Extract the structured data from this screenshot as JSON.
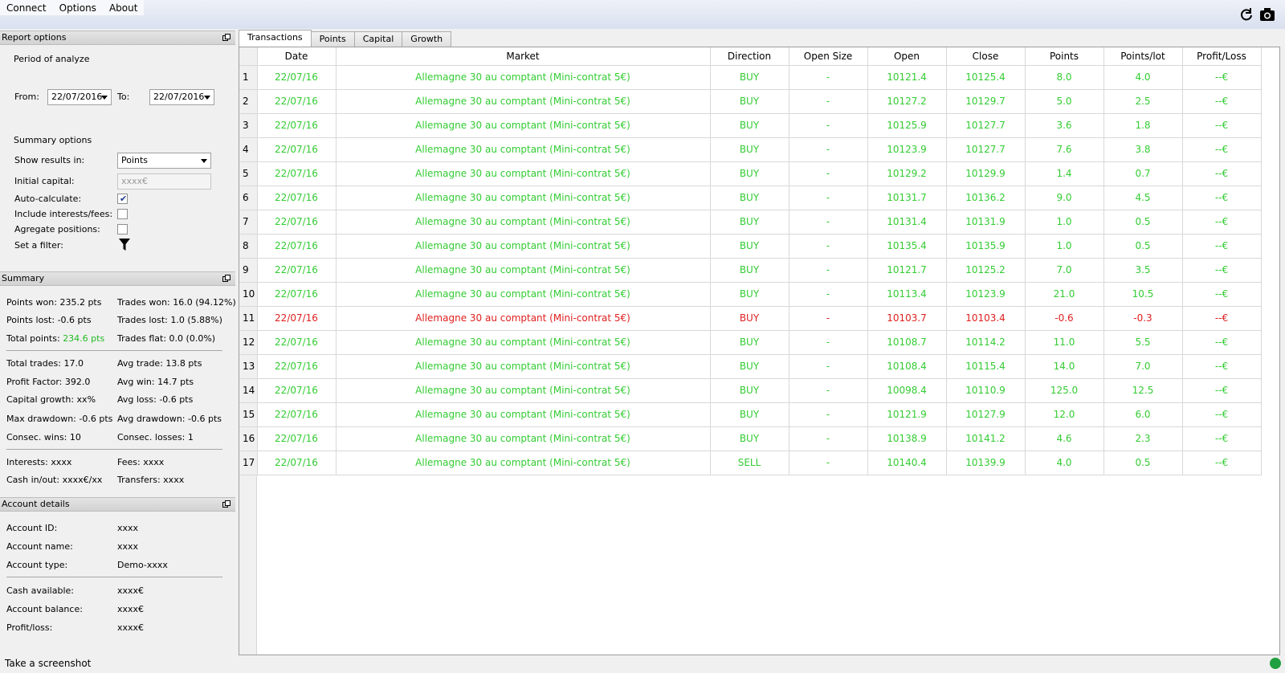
{
  "menu": [
    "Connect",
    "Options",
    "About"
  ],
  "toolbar": {
    "refresh_icon": "refresh-icon",
    "camera_icon": "camera-icon"
  },
  "report_options": {
    "header": "Report options",
    "period_label": "Period of analyze",
    "from_label": "From:",
    "from_value": "22/07/2016",
    "to_label": "To:",
    "to_value": "22/07/2016",
    "summary_options_label": "Summary options",
    "show_results_label": "Show results in:",
    "show_results_value": "Points",
    "initial_capital_label": "Initial capital:",
    "initial_capital_placeholder": "xxxx€",
    "auto_calculate_label": "Auto-calculate:",
    "auto_calculate_checked": true,
    "include_interests_label": "Include interests/fees:",
    "include_interests_checked": false,
    "aggregate_label": "Agregate positions:",
    "aggregate_checked": false,
    "filter_label": "Set a filter:"
  },
  "summary": {
    "header": "Summary",
    "points_won_label": "Points won:",
    "points_won": "235.2 pts",
    "trades_won_label": "Trades won:",
    "trades_won": "16.0 (94.12%)",
    "points_lost_label": "Points lost:",
    "points_lost": "-0.6 pts",
    "trades_lost_label": "Trades lost:",
    "trades_lost": "1.0 (5.88%)",
    "total_points_label": "Total points:",
    "total_points": "234.6 pts",
    "trades_flat_label": "Trades flat:",
    "trades_flat": "0.0 (0.0%)",
    "total_trades_label": "Total trades:",
    "total_trades": "17.0",
    "avg_trade_label": "Avg trade:",
    "avg_trade": "13.8 pts",
    "profit_factor_label": "Profit Factor:",
    "profit_factor": "392.0",
    "avg_win_label": "Avg win:",
    "avg_win": "14.7 pts",
    "capital_growth_label": "Capital growth:",
    "capital_growth": "xx%",
    "avg_loss_label": "Avg loss:",
    "avg_loss": "-0.6 pts",
    "max_drawdown_label": "Max drawdown:",
    "max_drawdown": "-0.6 pts",
    "avg_drawdown_label": "Avg drawdown:",
    "avg_drawdown": "-0.6 pts",
    "consec_wins_label": "Consec. wins:",
    "consec_wins": "10",
    "consec_losses_label": "Consec. losses:",
    "consec_losses": "1",
    "interests_label": "Interests:",
    "interests": "xxxx",
    "fees_label": "Fees:",
    "fees": "xxxx",
    "cash_inout_label": "Cash in/out:",
    "cash_inout": "xxxx€/xx",
    "transfers_label": "Transfers:",
    "transfers": "xxxx"
  },
  "account": {
    "header": "Account details",
    "id_label": "Account ID:",
    "id": "xxxx",
    "name_label": "Account name:",
    "name": "xxxx",
    "type_label": "Account type:",
    "type": "Demo-xxxx",
    "cash_label": "Cash available:",
    "cash": "xxxx€",
    "balance_label": "Account balance:",
    "balance": "xxxx€",
    "pl_label": "Profit/loss:",
    "pl": "xxxx€"
  },
  "tabs": [
    "Transactions",
    "Points",
    "Capital",
    "Growth"
  ],
  "table": {
    "columns": [
      "Date",
      "Market",
      "Direction",
      "Open Size",
      "Open",
      "Close",
      "Points",
      "Points/lot",
      "Profit/Loss"
    ],
    "rows": [
      {
        "n": "1",
        "date": "22/07/16",
        "market": "Allemagne 30 au comptant (Mini-contrat 5€)",
        "dir": "BUY",
        "size": "-",
        "open": "10121.4",
        "close": "10125.4",
        "points": "8.0",
        "ppl": "4.0",
        "pl": "--€",
        "state": "win"
      },
      {
        "n": "2",
        "date": "22/07/16",
        "market": "Allemagne 30 au comptant (Mini-contrat 5€)",
        "dir": "BUY",
        "size": "-",
        "open": "10127.2",
        "close": "10129.7",
        "points": "5.0",
        "ppl": "2.5",
        "pl": "--€",
        "state": "win"
      },
      {
        "n": "3",
        "date": "22/07/16",
        "market": "Allemagne 30 au comptant (Mini-contrat 5€)",
        "dir": "BUY",
        "size": "-",
        "open": "10125.9",
        "close": "10127.7",
        "points": "3.6",
        "ppl": "1.8",
        "pl": "--€",
        "state": "win"
      },
      {
        "n": "4",
        "date": "22/07/16",
        "market": "Allemagne 30 au comptant (Mini-contrat 5€)",
        "dir": "BUY",
        "size": "-",
        "open": "10123.9",
        "close": "10127.7",
        "points": "7.6",
        "ppl": "3.8",
        "pl": "--€",
        "state": "win"
      },
      {
        "n": "5",
        "date": "22/07/16",
        "market": "Allemagne 30 au comptant (Mini-contrat 5€)",
        "dir": "BUY",
        "size": "-",
        "open": "10129.2",
        "close": "10129.9",
        "points": "1.4",
        "ppl": "0.7",
        "pl": "--€",
        "state": "win"
      },
      {
        "n": "6",
        "date": "22/07/16",
        "market": "Allemagne 30 au comptant (Mini-contrat 5€)",
        "dir": "BUY",
        "size": "-",
        "open": "10131.7",
        "close": "10136.2",
        "points": "9.0",
        "ppl": "4.5",
        "pl": "--€",
        "state": "win"
      },
      {
        "n": "7",
        "date": "22/07/16",
        "market": "Allemagne 30 au comptant (Mini-contrat 5€)",
        "dir": "BUY",
        "size": "-",
        "open": "10131.4",
        "close": "10131.9",
        "points": "1.0",
        "ppl": "0.5",
        "pl": "--€",
        "state": "win"
      },
      {
        "n": "8",
        "date": "22/07/16",
        "market": "Allemagne 30 au comptant (Mini-contrat 5€)",
        "dir": "BUY",
        "size": "-",
        "open": "10135.4",
        "close": "10135.9",
        "points": "1.0",
        "ppl": "0.5",
        "pl": "--€",
        "state": "win"
      },
      {
        "n": "9",
        "date": "22/07/16",
        "market": "Allemagne 30 au comptant (Mini-contrat 5€)",
        "dir": "BUY",
        "size": "-",
        "open": "10121.7",
        "close": "10125.2",
        "points": "7.0",
        "ppl": "3.5",
        "pl": "--€",
        "state": "win"
      },
      {
        "n": "10",
        "date": "22/07/16",
        "market": "Allemagne 30 au comptant (Mini-contrat 5€)",
        "dir": "BUY",
        "size": "-",
        "open": "10113.4",
        "close": "10123.9",
        "points": "21.0",
        "ppl": "10.5",
        "pl": "--€",
        "state": "win"
      },
      {
        "n": "11",
        "date": "22/07/16",
        "market": "Allemagne 30 au comptant (Mini-contrat 5€)",
        "dir": "BUY",
        "size": "-",
        "open": "10103.7",
        "close": "10103.4",
        "points": "-0.6",
        "ppl": "-0.3",
        "pl": "--€",
        "state": "loss"
      },
      {
        "n": "12",
        "date": "22/07/16",
        "market": "Allemagne 30 au comptant (Mini-contrat 5€)",
        "dir": "BUY",
        "size": "-",
        "open": "10108.7",
        "close": "10114.2",
        "points": "11.0",
        "ppl": "5.5",
        "pl": "--€",
        "state": "win"
      },
      {
        "n": "13",
        "date": "22/07/16",
        "market": "Allemagne 30 au comptant (Mini-contrat 5€)",
        "dir": "BUY",
        "size": "-",
        "open": "10108.4",
        "close": "10115.4",
        "points": "14.0",
        "ppl": "7.0",
        "pl": "--€",
        "state": "win"
      },
      {
        "n": "14",
        "date": "22/07/16",
        "market": "Allemagne 30 au comptant (Mini-contrat 5€)",
        "dir": "BUY",
        "size": "-",
        "open": "10098.4",
        "close": "10110.9",
        "points": "125.0",
        "ppl": "12.5",
        "pl": "--€",
        "state": "win"
      },
      {
        "n": "15",
        "date": "22/07/16",
        "market": "Allemagne 30 au comptant (Mini-contrat 5€)",
        "dir": "BUY",
        "size": "-",
        "open": "10121.9",
        "close": "10127.9",
        "points": "12.0",
        "ppl": "6.0",
        "pl": "--€",
        "state": "win"
      },
      {
        "n": "16",
        "date": "22/07/16",
        "market": "Allemagne 30 au comptant (Mini-contrat 5€)",
        "dir": "BUY",
        "size": "-",
        "open": "10138.9",
        "close": "10141.2",
        "points": "4.6",
        "ppl": "2.3",
        "pl": "--€",
        "state": "win"
      },
      {
        "n": "17",
        "date": "22/07/16",
        "market": "Allemagne 30 au comptant (Mini-contrat 5€)",
        "dir": "SELL",
        "size": "-",
        "open": "10140.4",
        "close": "10139.9",
        "points": "4.0",
        "ppl": "0.5",
        "pl": "--€",
        "state": "win"
      }
    ]
  },
  "status": {
    "text": "Take a screenshot",
    "led_color": "#20a040"
  },
  "colors": {
    "win": "#33cc33",
    "loss": "#e02020"
  }
}
